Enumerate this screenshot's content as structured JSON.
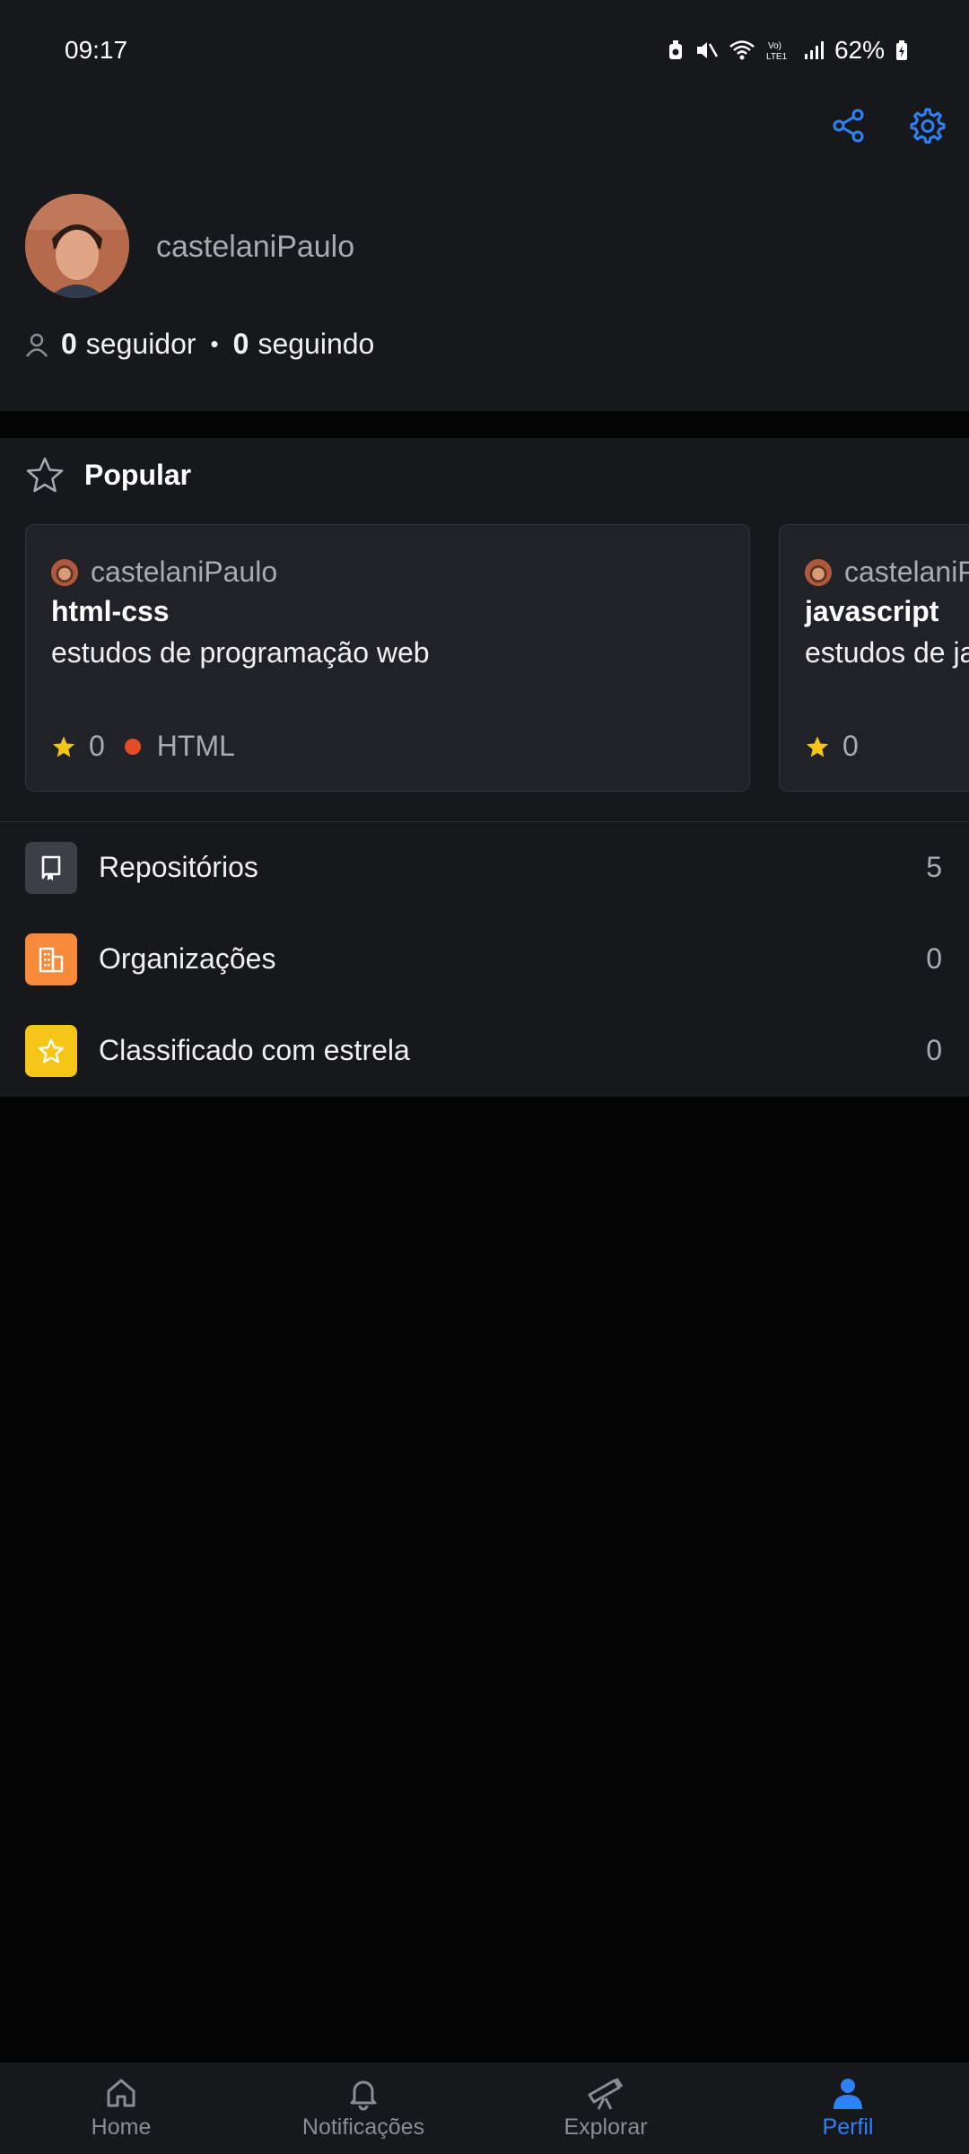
{
  "status_bar": {
    "time": "09:17",
    "battery": "62%"
  },
  "profile": {
    "username": "castelaniPaulo",
    "followers_count": "0",
    "followers_label": "seguidor",
    "separator": "•",
    "following_count": "0",
    "following_label": "seguindo"
  },
  "popular": {
    "title": "Popular",
    "repos": [
      {
        "owner": "castelaniPaulo",
        "name": "html-css",
        "description": "estudos de programação web",
        "stars": "0",
        "language": "HTML",
        "language_color": "#e34c26"
      },
      {
        "owner": "castelaniPaulo",
        "name": "javascript",
        "description": "estudos de javascript",
        "stars": "0"
      }
    ]
  },
  "menu": {
    "items": [
      {
        "label": "Repositórios",
        "count": "5",
        "icon": "repo-icon",
        "color": "#3d3f47"
      },
      {
        "label": "Organizações",
        "count": "0",
        "icon": "organization-icon",
        "color": "#f78a3b"
      },
      {
        "label": "Classificado com estrela",
        "count": "0",
        "icon": "star-icon",
        "color": "#f5c518"
      }
    ]
  },
  "bottom_nav": {
    "items": [
      {
        "label": "Home",
        "icon": "home-icon"
      },
      {
        "label": "Notificações",
        "icon": "bell-icon"
      },
      {
        "label": "Explorar",
        "icon": "telescope-icon"
      },
      {
        "label": "Perfil",
        "icon": "person-icon",
        "active": true
      }
    ]
  },
  "colors": {
    "background": "#040404",
    "surface": "#17181c",
    "card": "#212227",
    "accent": "#2f81f7",
    "star": "#f5c518"
  }
}
